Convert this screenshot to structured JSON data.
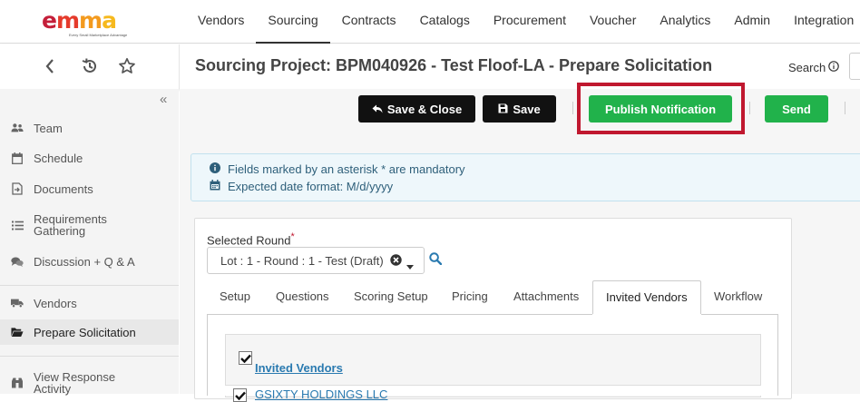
{
  "logo": {
    "part1": "e",
    "part2": "m",
    "part3": "m",
    "part4": "a",
    "tagline": "Every Small Marketplace Advantage"
  },
  "nav": {
    "items": [
      {
        "label": "Vendors"
      },
      {
        "label": "Sourcing"
      },
      {
        "label": "Contracts"
      },
      {
        "label": "Catalogs"
      },
      {
        "label": "Procurement"
      },
      {
        "label": "Voucher"
      },
      {
        "label": "Analytics"
      },
      {
        "label": "Admin"
      },
      {
        "label": "Integration"
      }
    ],
    "active_index": 1
  },
  "header": {
    "title": "Sourcing Project: BPM040926 - Test Floof-LA - Prepare Solicitation",
    "search_label": "Search"
  },
  "sidebar": {
    "items": [
      {
        "label": "Team",
        "icon": "users-icon"
      },
      {
        "label": "Schedule",
        "icon": "calendar-icon"
      },
      {
        "label": "Documents",
        "icon": "document-icon"
      },
      {
        "label": "Requirements Gathering",
        "icon": "list-icon"
      },
      {
        "label": "Discussion + Q & A",
        "icon": "comments-icon"
      },
      {
        "label": "Vendors",
        "icon": "truck-icon"
      },
      {
        "label": "Prepare Solicitation",
        "icon": "folder-open-icon"
      },
      {
        "label": "View Response Activity",
        "icon": "binoculars-icon"
      }
    ],
    "active_index": 6
  },
  "toolbar": {
    "save_close": "Save & Close",
    "save": "Save",
    "publish": "Publish Notification",
    "send": "Send"
  },
  "info": {
    "line1": "Fields marked by an asterisk * are mandatory",
    "line2": "Expected date format: M/d/yyyy"
  },
  "round": {
    "label": "Selected Round",
    "required_mark": "*",
    "value": "Lot : 1 - Round : 1 - Test (Draft)"
  },
  "tabs": {
    "items": [
      {
        "label": "Setup"
      },
      {
        "label": "Questions"
      },
      {
        "label": "Scoring Setup"
      },
      {
        "label": "Pricing"
      },
      {
        "label": "Attachments"
      },
      {
        "label": "Invited Vendors"
      },
      {
        "label": "Workflow"
      }
    ],
    "active_index": 5
  },
  "invited": {
    "header": "Invited Vendors",
    "first_vendor": "GSIXTY HOLDINGS LLC"
  },
  "colors": {
    "accent_green": "#21b24b",
    "highlight_red": "#c0182f",
    "dark_button": "#111111",
    "link_blue": "#2a7ab0"
  }
}
